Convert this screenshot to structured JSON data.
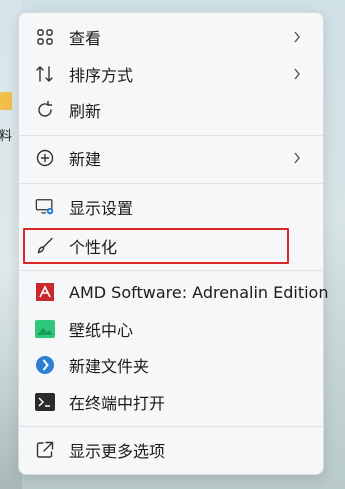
{
  "desktop": {
    "partial_label": "资料"
  },
  "menu": {
    "items": [
      {
        "label": "查看",
        "icon": "grid-icon",
        "has_submenu": true
      },
      {
        "label": "排序方式",
        "icon": "sort-icon",
        "has_submenu": true
      },
      {
        "label": "刷新",
        "icon": "refresh-icon",
        "has_submenu": false
      },
      {
        "label": "新建",
        "icon": "new-icon",
        "has_submenu": true
      },
      {
        "label": "显示设置",
        "icon": "display-settings-icon",
        "has_submenu": false
      },
      {
        "label": "个性化",
        "icon": "brush-icon",
        "has_submenu": false,
        "highlighted": true
      },
      {
        "label": "AMD Software: Adrenalin Edition",
        "icon": "amd-icon",
        "has_submenu": false
      },
      {
        "label": "壁纸中心",
        "icon": "wallpaper-icon",
        "has_submenu": false
      },
      {
        "label": "新建文件夹",
        "icon": "new-folder-icon",
        "has_submenu": false
      },
      {
        "label": "在终端中打开",
        "icon": "terminal-icon",
        "has_submenu": false
      },
      {
        "label": "显示更多选项",
        "icon": "more-options-icon",
        "has_submenu": false
      }
    ],
    "highlight_color": "#d9282a"
  }
}
